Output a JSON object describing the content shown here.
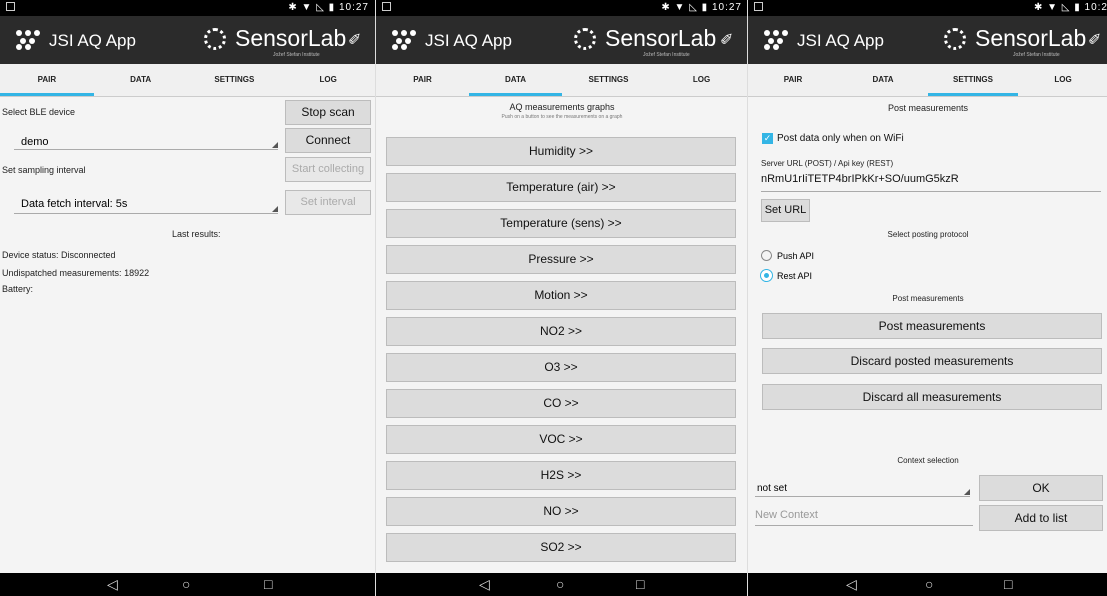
{
  "status": {
    "time1": "10:27",
    "time2": "10:27",
    "time3": "10:2",
    "icons": "✱ ▼ ◺ ▮"
  },
  "app": {
    "title": "JSI AQ App",
    "brand": "SensorLab",
    "brand_sub": "Jožef Stefan Institute"
  },
  "tabs": [
    "PAIR",
    "DATA",
    "SETTINGS",
    "LOG"
  ],
  "pair": {
    "select_label": "Select BLE device",
    "stop_scan": "Stop scan",
    "device_value": "demo",
    "connect": "Connect",
    "sampling_label": "Set sampling interval",
    "start_collecting": "Start collecting",
    "interval_value": "Data fetch interval: 5s",
    "set_interval": "Set interval",
    "last_results": "Last results:",
    "device_status": "Device status: Disconnected",
    "undispatched": "Undispatched measurements: 18922",
    "battery": "Battery:"
  },
  "data": {
    "heading": "AQ measurements graphs",
    "subheading": "Push on a button to see the measurements on a graph",
    "buttons": [
      "Humidity >>",
      "Temperature (air) >>",
      "Temperature (sens) >>",
      "Pressure >>",
      "Motion >>",
      "NO2 >>",
      "O3 >>",
      "CO >>",
      "VOC >>",
      "H2S >>",
      "NO >>",
      "SO2 >>"
    ]
  },
  "settings": {
    "post_heading": "Post measurements",
    "wifi_only": "Post data only when on WiFi",
    "server_label": "Server URL (POST) / Api key (REST)",
    "server_value": "nRmU1rIiTETP4brIPkKr+SO/uumG5kzR",
    "set_url": "Set URL",
    "protocol_heading": "Select posting protocol",
    "push_api": "Push API",
    "rest_api": "Rest API",
    "post_heading2": "Post measurements",
    "post_btn": "Post measurements",
    "discard_posted": "Discard posted measurements",
    "discard_all": "Discard all measurements",
    "context_heading": "Context selection",
    "context_value": "not set",
    "ok": "OK",
    "new_context_placeholder": "New Context",
    "add_to_list": "Add to list"
  },
  "nav": {
    "back": "◁",
    "home": "○",
    "recents": "□"
  },
  "colors": {
    "accent": "#33b5e5",
    "appbar": "#2b2b2b"
  }
}
